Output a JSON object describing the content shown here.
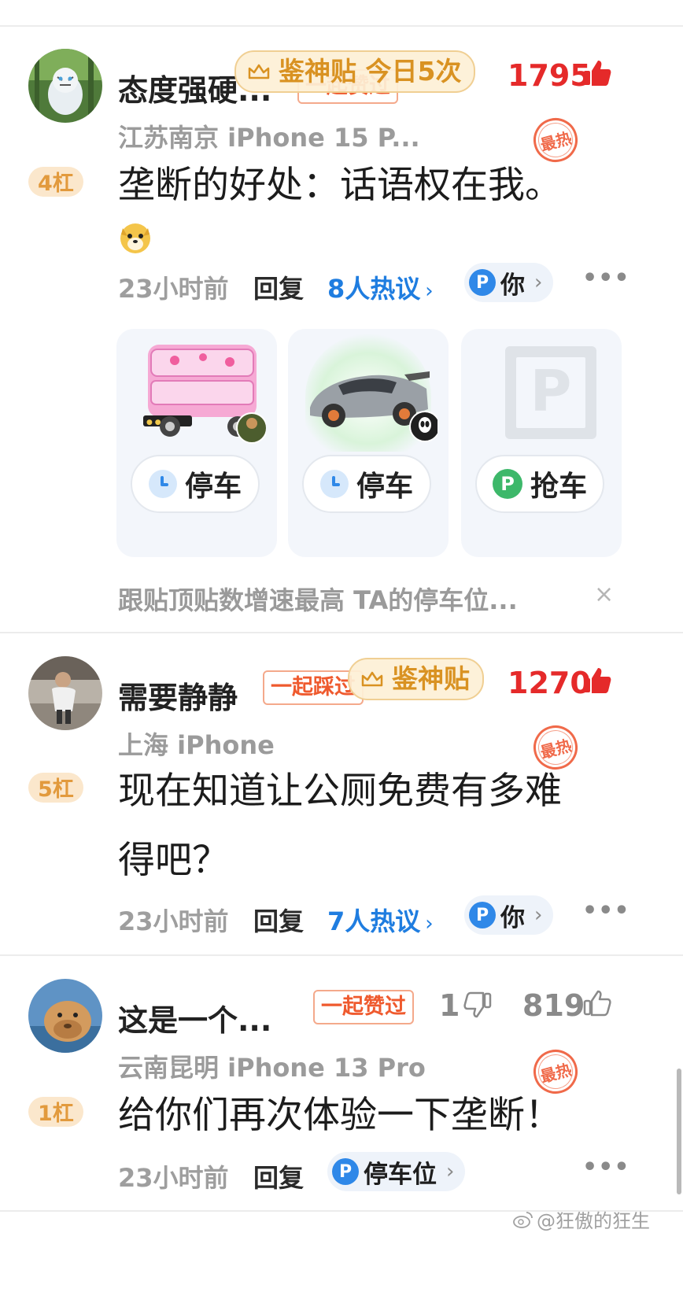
{
  "header_sliver": {
    "text": ""
  },
  "comments": [
    {
      "username": "态度强硬...",
      "tag": "一起赞过",
      "badge": "鉴神贴 今日5次",
      "likes": "1795",
      "meta": "江苏南京 iPhone 15 P...",
      "hot": "最热",
      "floor": "4杠",
      "text_lines": [
        "垄断的好处：话语权在我。"
      ],
      "time": "23小时前",
      "reply": "回复",
      "discuss": "8人热议",
      "park_label": "你"
    },
    {
      "username": "需要静静",
      "tag": "一起踩过",
      "badge": "鉴神贴",
      "likes": "1270",
      "meta": "上海 iPhone",
      "hot": "最热",
      "floor": "5杠",
      "text_lines": [
        "现在知道让公厕免费有多难",
        "得吧？"
      ],
      "time": "23小时前",
      "reply": "回复",
      "discuss": "7人热议",
      "park_label": "你"
    },
    {
      "username": "这是一个...",
      "tag": "一起赞过",
      "dislikes": "1",
      "likes": "819",
      "meta": "云南昆明 iPhone 13 Pro",
      "hot": "最热",
      "floor": "1杠",
      "text_lines": [
        "给你们再次体验一下垄断！"
      ],
      "time": "23小时前",
      "reply": "回复",
      "park_label": "停车位"
    }
  ],
  "parking": {
    "cards": [
      {
        "button": "停车"
      },
      {
        "button": "停车"
      },
      {
        "button": "抢车"
      }
    ],
    "notice": "跟贴顶贴数增速最高 TA的停车位...",
    "close": "×"
  },
  "watermark": "@狂傲的狂生",
  "colors": {
    "like_red": "#e52a2a",
    "link_blue": "#1f7de0",
    "badge_gold": "#d99222"
  }
}
